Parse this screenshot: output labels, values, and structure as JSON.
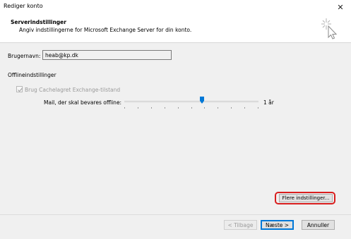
{
  "window": {
    "title": "Rediger konto",
    "close_glyph": "✕"
  },
  "header": {
    "title": "Serverindstillinger",
    "subtitle": "Angiv indstillingerne for Microsoft Exchange Server for din konto.",
    "icon": "exchange-server-icon"
  },
  "form": {
    "username_label": "Brugernavn:",
    "username_value": "heab@kp.dk",
    "offline_section_title": "Offlineindstillinger",
    "cached_mode_label": "Brug Cachelagret Exchange-tilstand",
    "cached_mode_checked": true,
    "cached_mode_enabled": false,
    "mail_offline_label": "Mail, der skal bevares offline:",
    "mail_offline_value": "1 år",
    "mail_offline_slider_fraction": 0.58,
    "slider_tick_count": 11
  },
  "buttons": {
    "more_settings": "Flere indstillinger...",
    "back": "< Tilbage",
    "next": "Næste >",
    "cancel": "Annuller"
  },
  "colors": {
    "highlight": "#d81e1e",
    "accent": "#0078d7",
    "panel_bg": "#f0f0f0"
  }
}
